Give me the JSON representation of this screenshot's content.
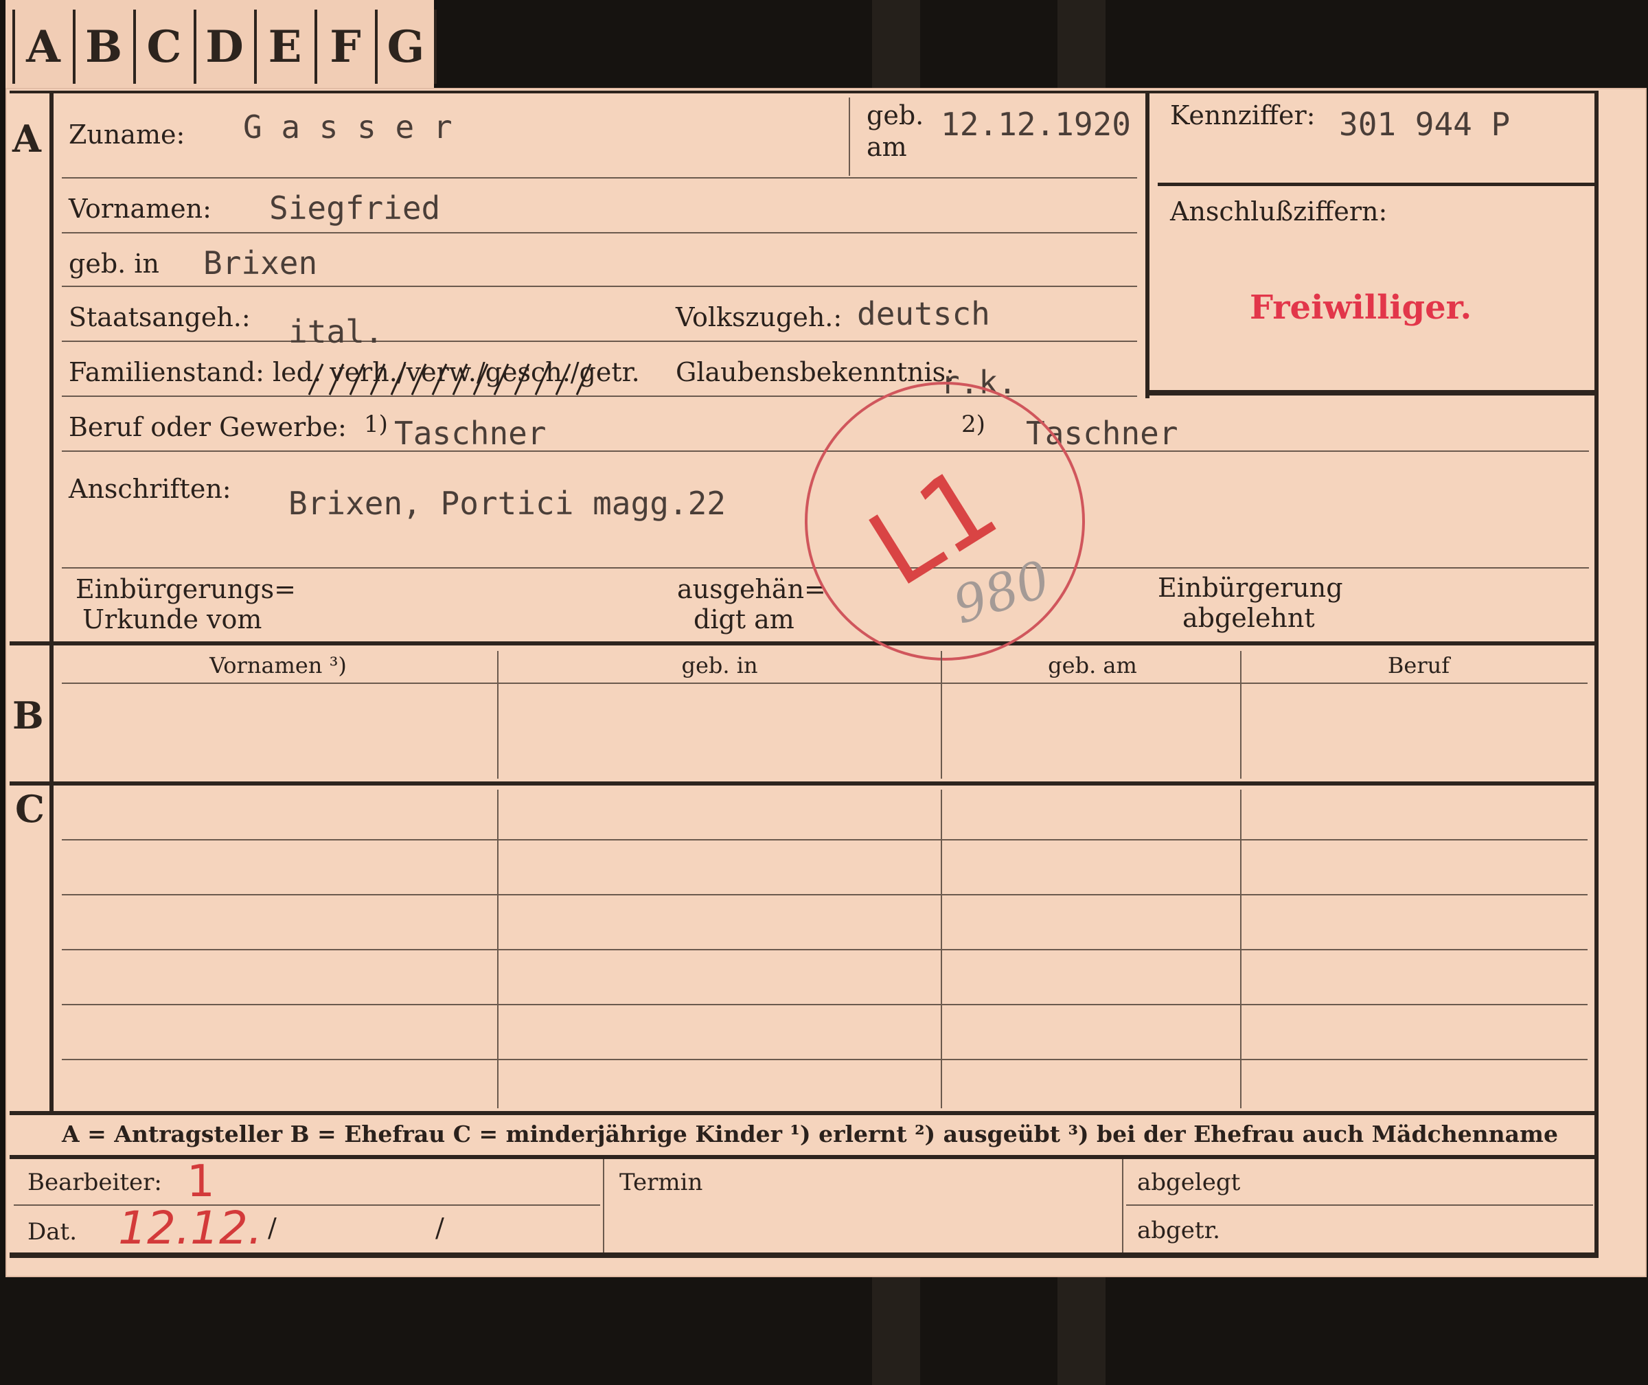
{
  "tabs": [
    "A",
    "B",
    "C",
    "D",
    "E",
    "F",
    "G"
  ],
  "sections": {
    "a": "A",
    "b": "B",
    "c": "C"
  },
  "section_a": {
    "zuname_label": "Zuname:",
    "zuname_value": "G a s s e r",
    "geb_am_label_1": "geb.",
    "geb_am_label_2": "am",
    "geb_am_value": "12.12.1920",
    "kennziffer_label": "Kennziffer:",
    "kennziffer_value": "301 944  P",
    "anschluss_label": "Anschlußziffern:",
    "stamp_freiwilliger": "Freiwilliger.",
    "vornamen_label": "Vornamen:",
    "vornamen_value": "Siegfried",
    "geb_in_label": "geb. in",
    "geb_in_value": "Brixen",
    "staatsangeh_label": "Staatsangeh.:",
    "staatsangeh_value": "ital.",
    "volkszugeh_label": "Volkszugeh.:",
    "volkszugeh_value": "deutsch",
    "familienstand_label": "Familienstand: led. verh./verw./gesch./getr.",
    "glaubens_label": "Glaubensbekenntnis:",
    "glaubens_value": "r.k.",
    "beruf_label": "Beruf oder Gewerbe:",
    "beruf_mark_1": "1)",
    "beruf_value_1": "Taschner",
    "beruf_mark_2": "2)",
    "beruf_value_2": "Taschner",
    "anschriften_label": "Anschriften:",
    "anschriften_value": "Brixen, Portici magg.22",
    "einbuergerung_label_1": "Einbürgerungs=",
    "einbuergerung_label_2": "Urkunde vom",
    "ausgehaendigt_label_1": "ausgehän=",
    "ausgehaendigt_label_2": "digt am",
    "abgelehnt_label_1": "Einbürgerung",
    "abgelehnt_label_2": "abgelehnt",
    "stamp_code": "L1",
    "stamp_pencil": "980"
  },
  "section_b": {
    "columns": [
      "Vornamen ³)",
      "geb. in",
      "geb. am",
      "Beruf"
    ]
  },
  "legend": "A = Antragsteller    B = Ehefrau    C = minderjährige Kinder    ¹) erlernt    ²) ausgeübt    ³) bei der Ehefrau auch Mädchenname",
  "footer": {
    "bearbeiter_label": "Bearbeiter:",
    "bearbeiter_value": "1",
    "dat_label": "Dat.",
    "dat_value": "12.12.",
    "dat_slash_1": "/",
    "dat_slash_2": "/",
    "termin_label": "Termin",
    "abgelegt_label": "abgelegt",
    "abgetr_label": "abgetr."
  },
  "colors": {
    "card": "#f5d4bd",
    "ink": "#2d241e",
    "stamp_red": "#d33a3a",
    "typewriter": "#4a3e38"
  }
}
